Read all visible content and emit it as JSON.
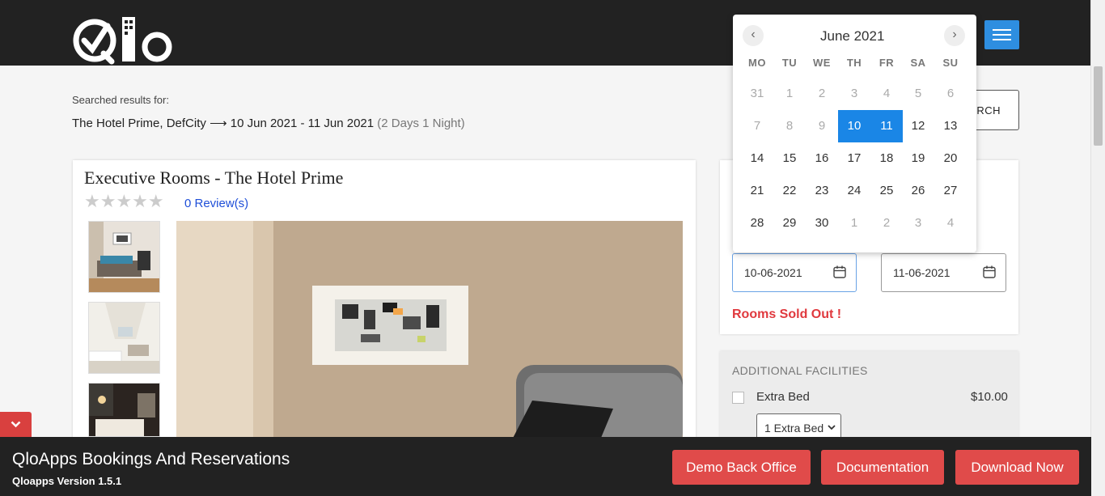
{
  "header": {
    "logo_text": "Qlo",
    "menu_icon": "hamburger-icon"
  },
  "search": {
    "label": "Searched results for:",
    "hotel": "The Hotel Prime, DefCity",
    "arrow": "⟶",
    "dates": "10 Jun 2021 - 11 Jun 2021",
    "duration": "(2 Days 1 Night)",
    "button_label": "SEARCH"
  },
  "room": {
    "title": "Executive Rooms - The Hotel Prime",
    "stars": "★★★★★",
    "rating": 0,
    "reviews_label": "0  Review(s)"
  },
  "booking": {
    "check_in": "10-06-2021",
    "check_out": "11-06-2021",
    "status": "Rooms Sold Out !"
  },
  "facilities": {
    "title": "ADDITIONAL FACILITIES",
    "items": [
      {
        "name": "Extra Bed",
        "price": "$10.00",
        "checked": false,
        "option": "1 Extra Bed"
      }
    ]
  },
  "datepicker": {
    "month_label": "June 2021",
    "prev": "‹",
    "next": "›",
    "weekdays": [
      "MO",
      "TU",
      "WE",
      "TH",
      "FR",
      "SA",
      "SU"
    ],
    "weeks": [
      [
        "31",
        "1",
        "2",
        "3",
        "4",
        "5",
        "6"
      ],
      [
        "7",
        "8",
        "9",
        "10",
        "11",
        "12",
        "13"
      ],
      [
        "14",
        "15",
        "16",
        "17",
        "18",
        "19",
        "20"
      ],
      [
        "21",
        "22",
        "23",
        "24",
        "25",
        "26",
        "27"
      ],
      [
        "28",
        "29",
        "30",
        "1",
        "2",
        "3",
        "4"
      ]
    ],
    "selected": [
      "10",
      "11"
    ],
    "accent": "#1a86e6"
  },
  "footer": {
    "title": "QloApps Bookings And Reservations",
    "version": "Qloapps Version 1.5.1",
    "buttons": [
      "Demo Back Office",
      "Documentation",
      "Download Now"
    ],
    "button_color": "#e04b4a"
  }
}
